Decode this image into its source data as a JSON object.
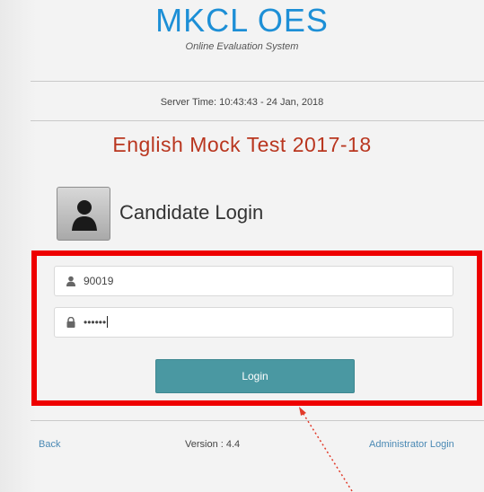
{
  "app": {
    "logo_title": "MKCL OES",
    "logo_subtitle": "Online Evaluation System",
    "server_time": "Server Time: 10:43:43 - 24 Jan, 2018",
    "test_title": "English Mock Test 2017-18"
  },
  "login": {
    "heading": "Candidate Login",
    "avatar_icon": "user-silhouette-icon",
    "username_value": "90019",
    "username_icon": "user-icon",
    "password_value": "••••••",
    "password_icon": "lock-icon",
    "button_label": "Login"
  },
  "footer": {
    "back_label": "Back",
    "version_label": "Version : 4.4",
    "admin_label": "Administrator Login"
  },
  "colors": {
    "brand_blue": "#1d8fd6",
    "title_red": "#b9361f",
    "button_teal": "#4a98a2",
    "highlight_red": "#ee0000"
  }
}
